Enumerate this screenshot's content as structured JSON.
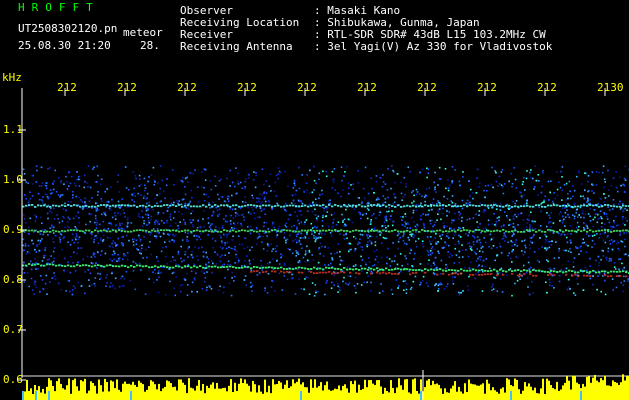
{
  "header": {
    "title": "HROFFT",
    "filename": "UT2508302120.pn",
    "mode": "meteor",
    "datetime": "25.08.30 21:20",
    "count": "28.",
    "info_labels": [
      "Observer",
      "Receiving Location",
      "Receiver",
      "Receiving Antenna"
    ],
    "info_values": [
      ": Masaki Kano",
      ": Shibukawa, Gunma, Japan",
      ": RTL-SDR SDR# 43dB L15 103.2MHz CW",
      ": 3el Yagi(V) Az 330 for Vladivostok"
    ]
  },
  "axes": {
    "y_unit": "kHz",
    "y_ticks": [
      "1.1",
      "1.0",
      "0.9",
      "0.8",
      "0.7",
      "0.6"
    ],
    "x_ticks": [
      "212",
      "212",
      "212",
      "212",
      "212",
      "212",
      "212",
      "212",
      "212",
      "2130"
    ]
  },
  "colors": {
    "background": "#000000",
    "grid": "#ffffff",
    "tick_text": "#ffff00",
    "header_text": "#ffffff",
    "title_text": "#00ff00",
    "noise": "#1040ff",
    "signal": "#ff3020",
    "amplitude": "#ffff00"
  }
}
